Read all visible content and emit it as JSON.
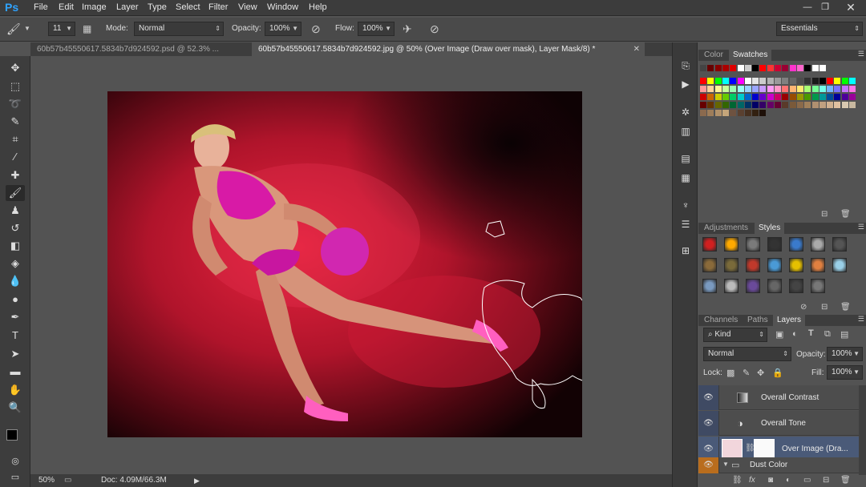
{
  "app": {
    "logo": "Ps",
    "menu": [
      "File",
      "Edit",
      "Image",
      "Layer",
      "Type",
      "Select",
      "Filter",
      "View",
      "Window",
      "Help"
    ],
    "window_controls": [
      "minimize-icon",
      "restore-icon",
      "close-icon"
    ]
  },
  "options": {
    "brush_size": "11",
    "mode_label": "Mode:",
    "mode_value": "Normal",
    "opacity_label": "Opacity:",
    "opacity_value": "100%",
    "flow_label": "Flow:",
    "flow_value": "100%",
    "workspace": "Essentials"
  },
  "tabs": [
    {
      "label": "60b57b45550617.5834b7d924592.psd @ 52.3% ...",
      "active": false
    },
    {
      "label": "60b57b45550617.5834b7d924592.jpg @ 50% (Over Image (Draw over mask), Layer Mask/8) *",
      "active": true
    }
  ],
  "status": {
    "zoom": "50%",
    "doc": "Doc: 4.09M/66.3M"
  },
  "panels": {
    "color_tabs": [
      "Color",
      "Swatches"
    ],
    "adjust_tabs": [
      "Adjustments",
      "Styles"
    ],
    "layer_tabs": [
      "Channels",
      "Paths",
      "Layers"
    ],
    "kind": "Kind",
    "blend": "Normal",
    "opacity_label": "Opacity:",
    "opacity_value": "100%",
    "lock_label": "Lock:",
    "fill_label": "Fill:",
    "fill_value": "100%",
    "layers": [
      {
        "name": "Overall Contrast",
        "selected": false
      },
      {
        "name": "Overall Tone",
        "selected": false
      },
      {
        "name": "Over Image (Dra...",
        "selected": true
      },
      {
        "name": "Dust Color",
        "selected": false
      }
    ]
  },
  "colors": {
    "accent": "#2fa3ff",
    "selected_layer": "#4a5a78",
    "eye_group": "#b96d1d"
  }
}
